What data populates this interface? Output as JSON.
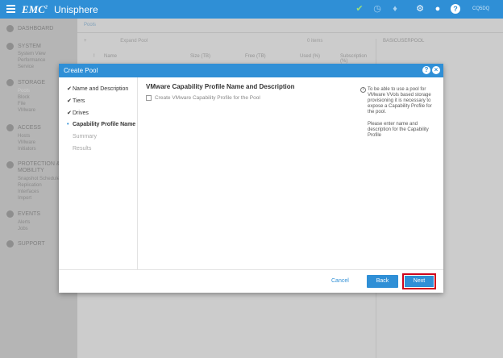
{
  "topbar": {
    "brand": "EMC",
    "brand_mark": "2",
    "app_name": "Unisphere",
    "right_label": "CQ5DQ"
  },
  "sidebar": {
    "sections": [
      {
        "title": "DASHBOARD",
        "items": []
      },
      {
        "title": "SYSTEM",
        "items": [
          "System View",
          "Performance",
          "Service"
        ]
      },
      {
        "title": "STORAGE",
        "items": [
          "Pools",
          "Block",
          "File",
          "VMware"
        ]
      },
      {
        "title": "ACCESS",
        "items": [
          "Hosts",
          "VMware",
          "Initiators"
        ]
      },
      {
        "title": "PROTECTION & MOBILITY",
        "items": [
          "Snapshot Schedule",
          "Replication",
          "Interfaces",
          "Import"
        ]
      },
      {
        "title": "EVENTS",
        "items": [
          "Alerts",
          "Jobs"
        ]
      },
      {
        "title": "SUPPORT",
        "items": []
      }
    ]
  },
  "main": {
    "tab": "Pools",
    "toolbar_label": "Expand Pool",
    "items_count": "0 items",
    "columns": [
      "!",
      "Name",
      "Size (TB)",
      "Free (TB)",
      "Used (%)",
      "Subscription (%)"
    ],
    "right_title": "BASICUSERPOOL"
  },
  "dialog": {
    "title": "Create Pool",
    "steps": [
      {
        "label": "Name and Description",
        "state": "done"
      },
      {
        "label": "Tiers",
        "state": "done"
      },
      {
        "label": "Drives",
        "state": "done"
      },
      {
        "label": "Capability Profile Name",
        "state": "current"
      },
      {
        "label": "Summary",
        "state": "pending"
      },
      {
        "label": "Results",
        "state": "pending"
      }
    ],
    "content_title": "VMware Capability Profile Name and Description",
    "checkbox_label": "Create VMware Capability Profile for the Pool",
    "checkbox_checked": false,
    "help_paragraph_1": "To be able to use a pool for VMware VVols based storage provisioning it is necessary to expose a Capability Profile for the pool.",
    "help_paragraph_2": "Please enter name and description for the Capability Profile",
    "cancel_label": "Cancel",
    "back_label": "Back",
    "next_label": "Next"
  },
  "colors": {
    "accent": "#2f8fd6",
    "highlight": "#d0021b",
    "ok": "#9be07a"
  }
}
